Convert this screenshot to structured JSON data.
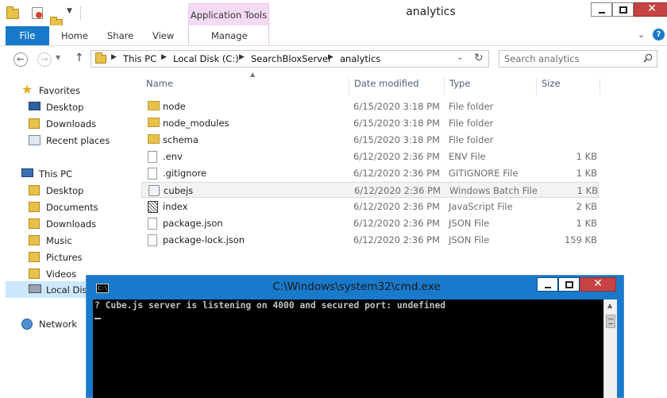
{
  "explorer": {
    "title": "analytics",
    "app_tools_label": "Application Tools",
    "tabs": {
      "file": "File",
      "home": "Home",
      "share": "Share",
      "view": "View",
      "manage": "Manage"
    },
    "breadcrumb": [
      "This PC",
      "Local Disk (C:)",
      "SearchBloxServer",
      "analytics"
    ],
    "search_placeholder": "Search analytics",
    "columns": {
      "name": "Name",
      "date": "Date modified",
      "type": "Type",
      "size": "Size"
    },
    "nav": {
      "favorites": "Favorites",
      "fav_items": [
        "Desktop",
        "Downloads",
        "Recent places"
      ],
      "this_pc": "This PC",
      "pc_items": [
        "Desktop",
        "Documents",
        "Downloads",
        "Music",
        "Pictures",
        "Videos",
        "Local Disk (C:)"
      ],
      "network": "Network"
    },
    "files": [
      {
        "name": "node",
        "date": "6/15/2020 3:18 PM",
        "type": "File folder",
        "size": "",
        "icon": "folder-icon"
      },
      {
        "name": "node_modules",
        "date": "6/15/2020 3:18 PM",
        "type": "File folder",
        "size": "",
        "icon": "folder-icon"
      },
      {
        "name": "schema",
        "date": "6/15/2020 3:18 PM",
        "type": "File folder",
        "size": "",
        "icon": "folder-icon"
      },
      {
        "name": ".env",
        "date": "6/12/2020 2:36 PM",
        "type": "ENV File",
        "size": "1 KB",
        "icon": "file-icon"
      },
      {
        "name": ".gitignore",
        "date": "6/12/2020 2:36 PM",
        "type": "GITIGNORE File",
        "size": "1 KB",
        "icon": "file-icon"
      },
      {
        "name": "cubejs",
        "date": "6/12/2020 2:36 PM",
        "type": "Windows Batch File",
        "size": "1 KB",
        "icon": "batch-file-icon"
      },
      {
        "name": "index",
        "date": "6/12/2020 2:36 PM",
        "type": "JavaScript File",
        "size": "2 KB",
        "icon": "js-file-icon"
      },
      {
        "name": "package.json",
        "date": "6/12/2020 2:36 PM",
        "type": "JSON File",
        "size": "1 KB",
        "icon": "file-icon"
      },
      {
        "name": "package-lock.json",
        "date": "6/12/2020 2:36 PM",
        "type": "JSON File",
        "size": "159 KB",
        "icon": "file-icon"
      }
    ],
    "selected_file": "cubejs"
  },
  "cmd": {
    "title": "C:\\Windows\\system32\\cmd.exe",
    "output": "? Cube.js server is listening on 4000 and secured port: undefined"
  },
  "colors": {
    "accent": "#1979ca",
    "app_tools": "#f4dbf5",
    "console_bg": "#000000",
    "console_text": "#c0c0c0",
    "close_button": "#c74343"
  }
}
